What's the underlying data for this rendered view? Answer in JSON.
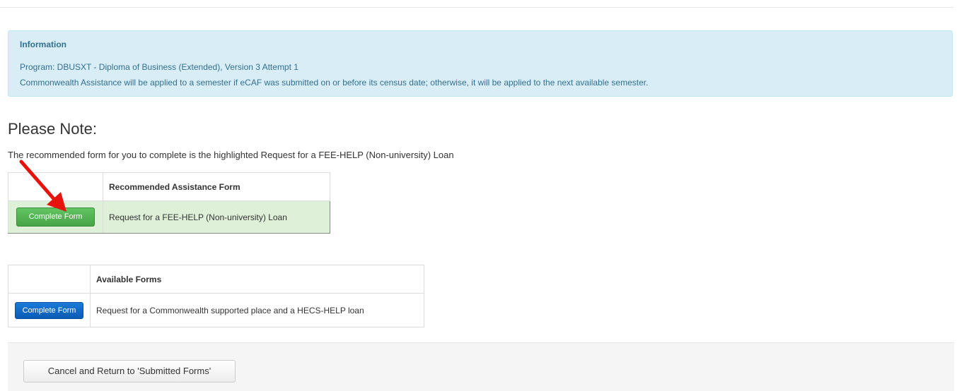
{
  "info": {
    "title": "Information",
    "program": "Program: DBUSXT - Diploma of Business (Extended), Version 3 Attempt 1",
    "notice": "Commonwealth Assistance will be applied to a semester if eCAF was submitted on or before its census date; otherwise, it will be applied to the next available semester."
  },
  "note": {
    "heading": "Please Note:",
    "text": "The recommended form for you to complete is the highlighted Request for a FEE-HELP (Non-university) Loan"
  },
  "recommended": {
    "header": "Recommended Assistance Form",
    "rows": [
      {
        "button": "Complete Form",
        "name": "Request for a FEE-HELP (Non-university) Loan"
      }
    ]
  },
  "available": {
    "header": "Available Forms",
    "rows": [
      {
        "button": "Complete Form",
        "name": "Request for a Commonwealth supported place and a HECS-HELP loan"
      }
    ]
  },
  "footer": {
    "cancel_label": "Cancel and Return to 'Submitted Forms'"
  },
  "colors": {
    "info_bg": "#d9edf7",
    "info_text": "#31708f",
    "highlight_bg": "#dff0d8",
    "green_button": "#47a447",
    "blue_button": "#0b5bb5",
    "annotation_arrow": "#e8130c"
  },
  "icons": {
    "annotation": "red-arrow-icon"
  }
}
